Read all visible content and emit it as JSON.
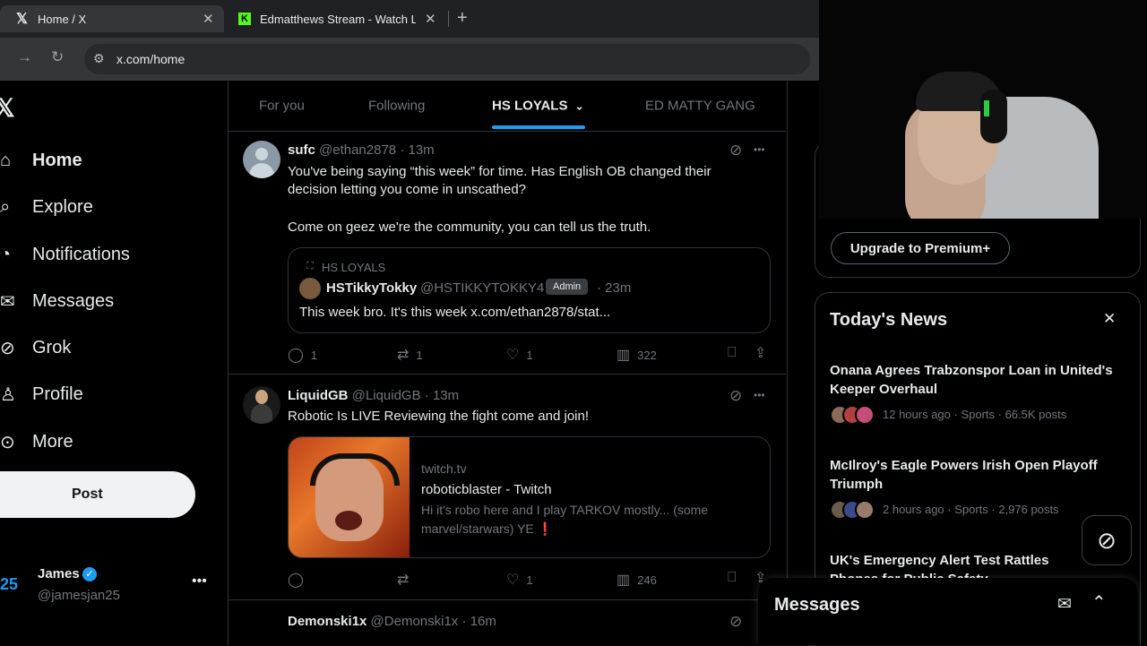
{
  "browser": {
    "tabs": [
      {
        "title": "Home / X"
      },
      {
        "title": "Edmatthews Stream - Watch Live"
      }
    ],
    "url": "x.com/home"
  },
  "sidebar": {
    "items": [
      {
        "label": "Home"
      },
      {
        "label": "Explore"
      },
      {
        "label": "Notifications"
      },
      {
        "label": "Messages"
      },
      {
        "label": "Grok"
      },
      {
        "label": "Profile"
      },
      {
        "label": "More"
      }
    ],
    "post_label": "Post",
    "account": {
      "name": "James",
      "handle": "@jamesjan25",
      "avatar_text": "25"
    }
  },
  "feed_tabs": [
    {
      "label": "For you"
    },
    {
      "label": "Following"
    },
    {
      "label": "HS LOYALS"
    },
    {
      "label": "ED MATTY GANG"
    }
  ],
  "tweets": [
    {
      "name": "sufc",
      "handle": "@ethan2878",
      "time": "· 13m",
      "text1": "You've being saying “this week” for time. Has English OB changed their decision letting you come in unscathed?",
      "text2": "Come on geez we're the community, you can tell us the truth.",
      "quote": {
        "community": "HS LOYALS",
        "name": "HSTikkyTokky",
        "handle": "@HSTIKKYTOKKY4",
        "badge": "Admin",
        "time": "· 23m",
        "text": "This week bro. It's this week x.com/ethan2878/stat..."
      },
      "replies": "1",
      "reposts": "1",
      "likes": "1",
      "views": "322"
    },
    {
      "name": "LiquidGB",
      "handle": "@LiquidGB",
      "time": "· 13m",
      "text1": "Robotic Is LIVE Reviewing the fight come and join!",
      "card": {
        "domain": "twitch.tv",
        "title": "roboticblaster - Twitch",
        "desc1": "Hi it's robo here and I play TARKOV mostly... (some",
        "desc2": "marvel/starwars) YE ❗"
      },
      "replies": "",
      "reposts": "",
      "likes": "1",
      "views": "246"
    },
    {
      "name": "Demonski1x",
      "handle": "@Demonski1x",
      "time": "· 16m"
    }
  ],
  "premium": {
    "button": "Upgrade to Premium+"
  },
  "news": {
    "heading": "Today's News",
    "items": [
      {
        "title": "Onana Agrees Trabzonspor Loan in United's Keeper Overhaul",
        "meta": "12 hours ago · Sports · 66.5K posts"
      },
      {
        "title": "McIlroy's Eagle Powers Irish Open Playoff Triumph",
        "meta": "2 hours ago · Sports · 2,976 posts"
      },
      {
        "title": "UK's Emergency Alert Test Rattles Phones for Public Safety",
        "meta": ""
      }
    ]
  },
  "messages_drawer": {
    "title": "Messages"
  },
  "colors": {
    "accent": "#1d9bf0",
    "bg": "#000000",
    "border": "#2f3336",
    "muted": "#71767b",
    "text": "#e7e9ea"
  }
}
